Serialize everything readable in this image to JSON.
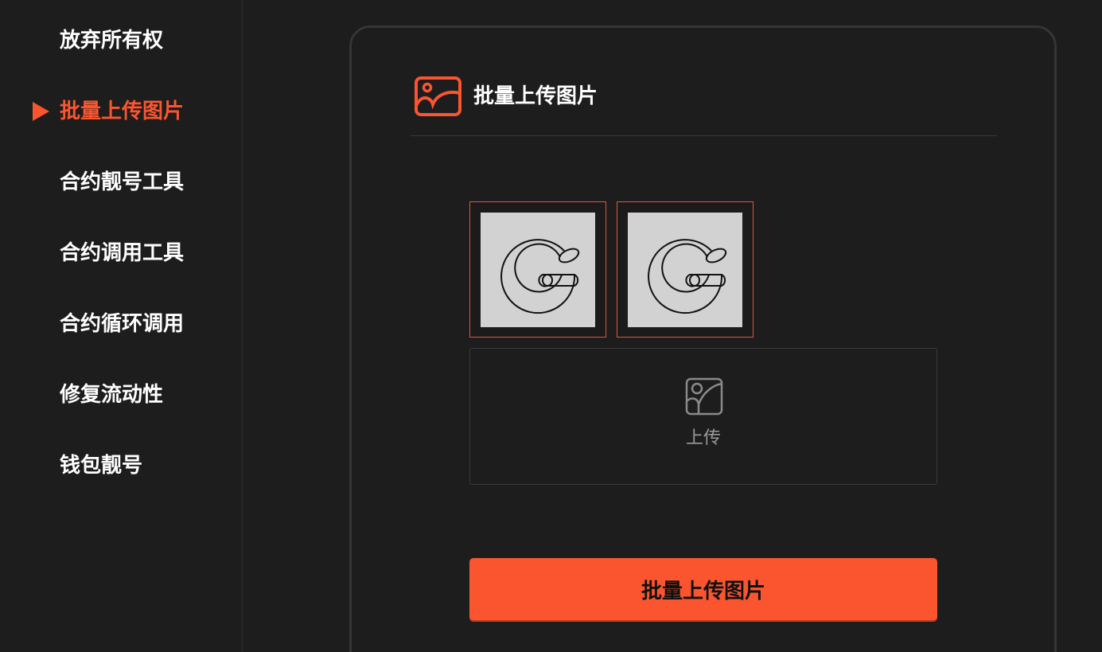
{
  "sidebar": {
    "items": [
      {
        "label": "放弃所有权",
        "active": false
      },
      {
        "label": "批量上传图片",
        "active": true
      },
      {
        "label": "合约靓号工具",
        "active": false
      },
      {
        "label": "合约调用工具",
        "active": false
      },
      {
        "label": "合约循环调用",
        "active": false
      },
      {
        "label": "修复流动性",
        "active": false
      },
      {
        "label": "钱包靓号",
        "active": false
      }
    ]
  },
  "card": {
    "title": "批量上传图片",
    "header_icon": "image-icon",
    "thumbnails": [
      {
        "icon": "logo-g-icon"
      },
      {
        "icon": "logo-g-icon"
      }
    ],
    "upload": {
      "label": "上传",
      "icon": "image-upload-icon"
    },
    "submit_label": "批量上传图片"
  },
  "colors": {
    "accent": "#fb5530",
    "background": "#1d1d1d",
    "text": "#ffffff",
    "muted_text": "#9a9a9a",
    "thumb_border": "#e5533c",
    "thumb_bg": "#d2d2d2"
  }
}
